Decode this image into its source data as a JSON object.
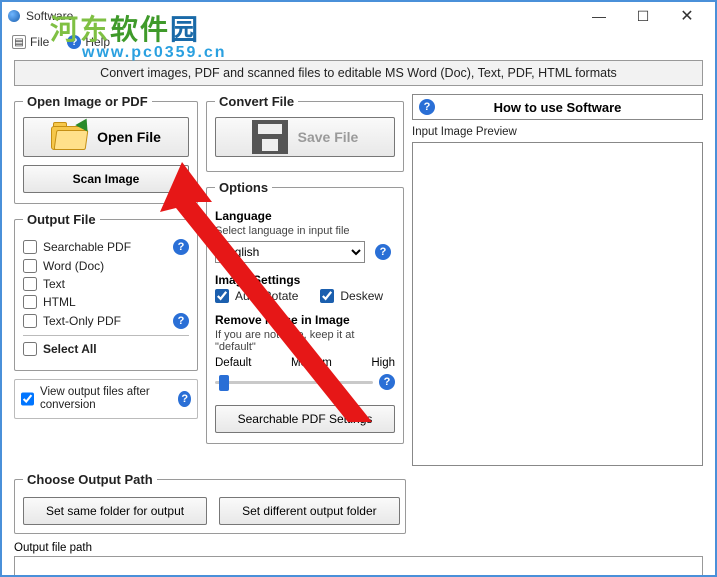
{
  "window": {
    "title": "Software"
  },
  "menu": {
    "file": "File",
    "help": "Help"
  },
  "watermark": {
    "line1a": "河东",
    "line1b": "软件",
    "line1c": "园",
    "line2": "www.pc0359.cn"
  },
  "banner": "Convert images, PDF and scanned files to editable MS Word (Doc), Text, PDF, HTML formats",
  "open_group": {
    "legend": "Open Image or PDF",
    "open_file": "Open File",
    "scan_image": "Scan Image"
  },
  "convert_group": {
    "legend": "Convert File",
    "save_file": "Save File"
  },
  "output_group": {
    "legend": "Output File",
    "items": [
      "Searchable PDF",
      "Word (Doc)",
      "Text",
      "HTML",
      "Text-Only PDF"
    ],
    "select_all": "Select All",
    "view_output": "View output files after conversion"
  },
  "options": {
    "legend": "Options",
    "language_head": "Language",
    "language_desc": "Select language in input file",
    "language_value": "English",
    "image_settings_head": "Image Settings",
    "auto_rotate": "Auto Rotate",
    "deskew": "Deskew",
    "noise_head": "Remove Noise in Image",
    "noise_desc": "If you are not sure, keep it at \"default\"",
    "noise_labels": [
      "Default",
      "Medium",
      "High"
    ],
    "searchable_btn": "Searchable PDF Settings"
  },
  "right": {
    "how_to": "How to use Software",
    "preview_label": "Input Image Preview"
  },
  "path": {
    "legend": "Choose Output Path",
    "same": "Set same folder for output",
    "diff": "Set different output folder",
    "out_label": "Output file path"
  }
}
